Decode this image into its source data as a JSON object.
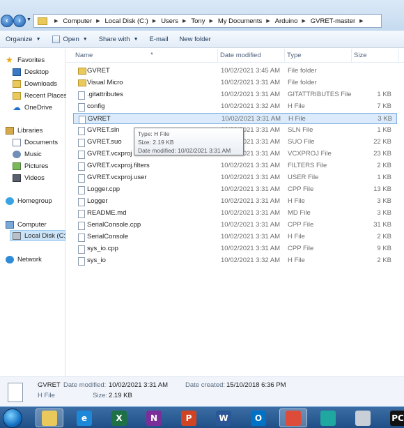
{
  "address": {
    "crumbs": [
      "Computer",
      "Local Disk (C:)",
      "Users",
      "Tony",
      "My Documents",
      "Arduino",
      "GVRET-master"
    ]
  },
  "toolbar": {
    "organize": "Organize",
    "open": "Open",
    "share_with": "Share with",
    "email": "E-mail",
    "new_folder": "New folder"
  },
  "nav": {
    "favorites": "Favorites",
    "desktop": "Desktop",
    "downloads": "Downloads",
    "recent_places": "Recent Places",
    "onedrive": "OneDrive",
    "libraries": "Libraries",
    "documents": "Documents",
    "music": "Music",
    "pictures": "Pictures",
    "videos": "Videos",
    "homegroup": "Homegroup",
    "computer": "Computer",
    "local_disk": "Local Disk (C:)",
    "network": "Network"
  },
  "columns": {
    "name": "Name",
    "date_modified": "Date modified",
    "type": "Type",
    "size": "Size"
  },
  "files": [
    {
      "name": "GVRET",
      "date": "10/02/2021 3:45 AM",
      "type": "File folder",
      "size": "",
      "kind": "folder"
    },
    {
      "name": "Visual Micro",
      "date": "10/02/2021 3:31 AM",
      "type": "File folder",
      "size": "",
      "kind": "folder"
    },
    {
      "name": ".gitattributes",
      "date": "10/02/2021 3:31 AM",
      "type": "GITATTRIBUTES File",
      "size": "1 KB",
      "kind": "file"
    },
    {
      "name": "config",
      "date": "10/02/2021 3:32 AM",
      "type": "H File",
      "size": "7 KB",
      "kind": "file"
    },
    {
      "name": "GVRET",
      "date": "10/02/2021 3:31 AM",
      "type": "H File",
      "size": "3 KB",
      "kind": "file",
      "selected": true
    },
    {
      "name": "GVRET.sln",
      "date": "10/02/2021 3:31 AM",
      "type": "SLN File",
      "size": "1 KB",
      "kind": "file"
    },
    {
      "name": "GVRET.suo",
      "date": "10/02/2021 3:31 AM",
      "type": "SUO File",
      "size": "22 KB",
      "kind": "file"
    },
    {
      "name": "GVRET.vcxproj",
      "date": "10/02/2021 3:31 AM",
      "type": "VCXPROJ File",
      "size": "23 KB",
      "kind": "file"
    },
    {
      "name": "GVRET.vcxproj.filters",
      "date": "10/02/2021 3:31 AM",
      "type": "FILTERS File",
      "size": "2 KB",
      "kind": "file"
    },
    {
      "name": "GVRET.vcxproj.user",
      "date": "10/02/2021 3:31 AM",
      "type": "USER File",
      "size": "1 KB",
      "kind": "file"
    },
    {
      "name": "Logger.cpp",
      "date": "10/02/2021 3:31 AM",
      "type": "CPP File",
      "size": "13 KB",
      "kind": "file"
    },
    {
      "name": "Logger",
      "date": "10/02/2021 3:31 AM",
      "type": "H File",
      "size": "3 KB",
      "kind": "file"
    },
    {
      "name": "README.md",
      "date": "10/02/2021 3:31 AM",
      "type": "MD File",
      "size": "3 KB",
      "kind": "file"
    },
    {
      "name": "SerialConsole.cpp",
      "date": "10/02/2021 3:31 AM",
      "type": "CPP File",
      "size": "31 KB",
      "kind": "file"
    },
    {
      "name": "SerialConsole",
      "date": "10/02/2021 3:31 AM",
      "type": "H File",
      "size": "2 KB",
      "kind": "file"
    },
    {
      "name": "sys_io.cpp",
      "date": "10/02/2021 3:31 AM",
      "type": "CPP File",
      "size": "9 KB",
      "kind": "file"
    },
    {
      "name": "sys_io",
      "date": "10/02/2021 3:32 AM",
      "type": "H File",
      "size": "2 KB",
      "kind": "file"
    }
  ],
  "tooltip": {
    "type": "Type: H File",
    "size": "Size: 2.19 KB",
    "date": "Date modified: 10/02/2021 3:31 AM"
  },
  "details": {
    "name": "GVRET",
    "kind": "H File",
    "date_modified_label": "Date modified:",
    "date_modified": "10/02/2021 3:31 AM",
    "date_created_label": "Date created:",
    "date_created": "15/10/2018 6:36 PM",
    "size_label": "Size:",
    "size": "2.19 KB"
  },
  "taskbar": {
    "apps": [
      {
        "icon": "file-explorer-icon",
        "glyph": "",
        "color": "#e9c95c",
        "active": true
      },
      {
        "icon": "edge-legacy-icon",
        "glyph": "e",
        "color": "#1e88d8",
        "active": false
      },
      {
        "icon": "excel-icon",
        "glyph": "X",
        "color": "#1e7145",
        "active": false
      },
      {
        "icon": "onenote-icon",
        "glyph": "N",
        "color": "#7b2e9a",
        "active": false
      },
      {
        "icon": "powerpoint-icon",
        "glyph": "P",
        "color": "#d04423",
        "active": false
      },
      {
        "icon": "word-icon",
        "glyph": "W",
        "color": "#2b5797",
        "active": false
      },
      {
        "icon": "outlook-icon",
        "glyph": "O",
        "color": "#0072c6",
        "active": false
      },
      {
        "icon": "chrome-icon",
        "glyph": "",
        "color": "#dd4b39",
        "active": true
      },
      {
        "icon": "edge-icon",
        "glyph": "",
        "color": "#1fa7a0",
        "active": false
      },
      {
        "icon": "calculator-icon",
        "glyph": "",
        "color": "#c9cfd6",
        "active": false
      },
      {
        "icon": "pycharm-icon",
        "glyph": "PC",
        "color": "#111111",
        "active": false
      }
    ]
  }
}
